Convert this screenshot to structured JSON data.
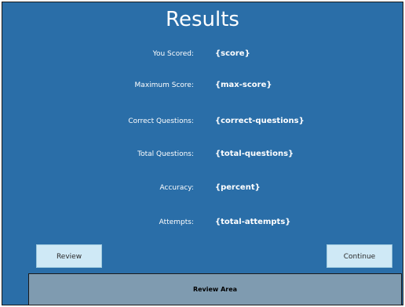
{
  "title": "Results",
  "stats": [
    {
      "label": "You Scored:",
      "value": "{score}"
    },
    {
      "label": "Maximum Score:",
      "value": "{max-score}"
    },
    {
      "label": "Correct Questions:",
      "value": "{correct-questions}"
    },
    {
      "label": "Total Questions:",
      "value": "{total-questions}"
    },
    {
      "label": "Accuracy:",
      "value": "{percent}"
    },
    {
      "label": "Attempts:",
      "value": "{total-attempts}"
    }
  ],
  "buttons": {
    "review_label": "Review",
    "continue_label": "Continue"
  },
  "review_area": {
    "title": "Review Area"
  },
  "colors": {
    "background": "#2a6ea8",
    "button": "#cfe9f6",
    "review_area": "#7f9bb0"
  }
}
